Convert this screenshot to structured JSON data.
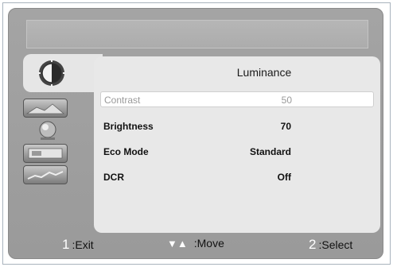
{
  "menu": {
    "title": "Luminance",
    "tabs": [
      {
        "icon": "sun-half-icon",
        "selected": true
      },
      {
        "icon": "picture-icon",
        "selected": false
      },
      {
        "icon": "color-globe-icon",
        "selected": false
      },
      {
        "icon": "osd-settings-icon",
        "selected": false
      },
      {
        "icon": "setup-icon",
        "selected": false
      }
    ],
    "items": [
      {
        "label": "Contrast",
        "value": "50",
        "selected": true
      },
      {
        "label": "Brightness",
        "value": "70",
        "selected": false
      },
      {
        "label": "Eco Mode",
        "value": "Standard",
        "selected": false
      },
      {
        "label": "DCR",
        "value": "Off",
        "selected": false
      }
    ]
  },
  "footer": {
    "exit_key": "1",
    "exit_label": ":Exit",
    "move_key": "▼▲",
    "move_label": ":Move",
    "select_key": "2",
    "select_label": ":Select"
  },
  "colors": {
    "osd_background": "#a0a0a0",
    "panel_background": "#e8e8e8",
    "selected_row": "#ffffff"
  }
}
